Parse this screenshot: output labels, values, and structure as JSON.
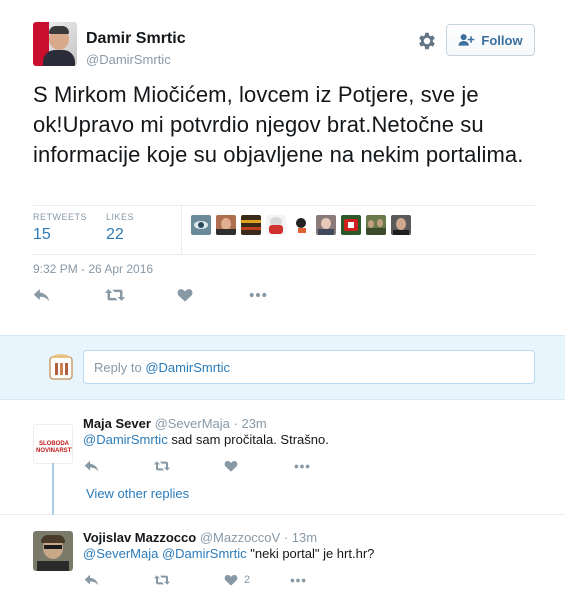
{
  "tweet": {
    "author": {
      "fullname": "Damir Smrtic",
      "handle": "@DamirSmrtic"
    },
    "follow_label": "Follow",
    "text": "S Mirkom Miočićem, lovcem iz Potjere, sve je ok!Upravo mi potvrdio njegov brat.Netočne su informacije koje su objavljene na nekim portalima.",
    "stats": {
      "retweets_label": "RETWEETS",
      "retweets": "15",
      "likes_label": "LIKES",
      "likes": "22"
    },
    "likers": [
      "eye-avatar",
      "face-avatar",
      "stripes-avatar",
      "cartoon-avatar",
      "tools-avatar",
      "portrait-avatar",
      "flag-avatar",
      "soldiers-avatar",
      "man-avatar"
    ],
    "timestamp": "9:32 PM - 26 Apr 2016",
    "actions": [
      "reply-icon",
      "retweet-icon",
      "like-icon",
      "more-icon"
    ]
  },
  "reply_box": {
    "placeholder_prefix": "Reply to ",
    "placeholder_mention": "@DamirSmrtic"
  },
  "replies": [
    {
      "name": "Maja Sever",
      "handle": "@SeverMaja",
      "time": "· 23m",
      "mention": "@DamirSmrtic",
      "text": " sad sam pročitala. Strašno.",
      "avatar_text": "SLOBODA NOVINARSTVU",
      "like_count": ""
    },
    {
      "name": "Vojislav Mazzocco",
      "handle": "@MazzoccoV",
      "time": "· 13m",
      "mention": "@SeverMaja @DamirSmrtic",
      "text": " \"neki portal\" je hrt.hr?",
      "like_count": "2"
    }
  ],
  "view_other_replies": "View other replies",
  "colors": {
    "link": "#2b7bb9",
    "muted": "#8899a6",
    "reply_bg": "#e8f5fd"
  }
}
